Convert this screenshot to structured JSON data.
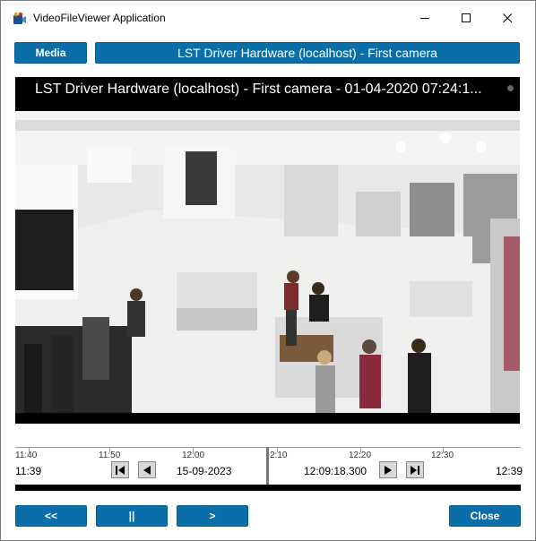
{
  "window": {
    "title": "VideoFileViewer Application"
  },
  "toolbar": {
    "media_label": "Media",
    "camera_label": "LST Driver Hardware (localhost) - First camera"
  },
  "video": {
    "caption": "LST Driver Hardware (localhost) - First camera - 01-04-2020 07:24:1..."
  },
  "timeline": {
    "ticks": [
      "11:40",
      "11:50",
      "12:00",
      "2:10",
      "12:20",
      "12:30"
    ],
    "start_time": "11:39",
    "date": "15-09-2023",
    "current_time": "12:09:18.300",
    "end_time": "12:39"
  },
  "controls": {
    "prev_label": "<<",
    "pause_label": "||",
    "next_label": ">",
    "close_label": "Close"
  },
  "colors": {
    "accent": "#0a6fa8"
  }
}
